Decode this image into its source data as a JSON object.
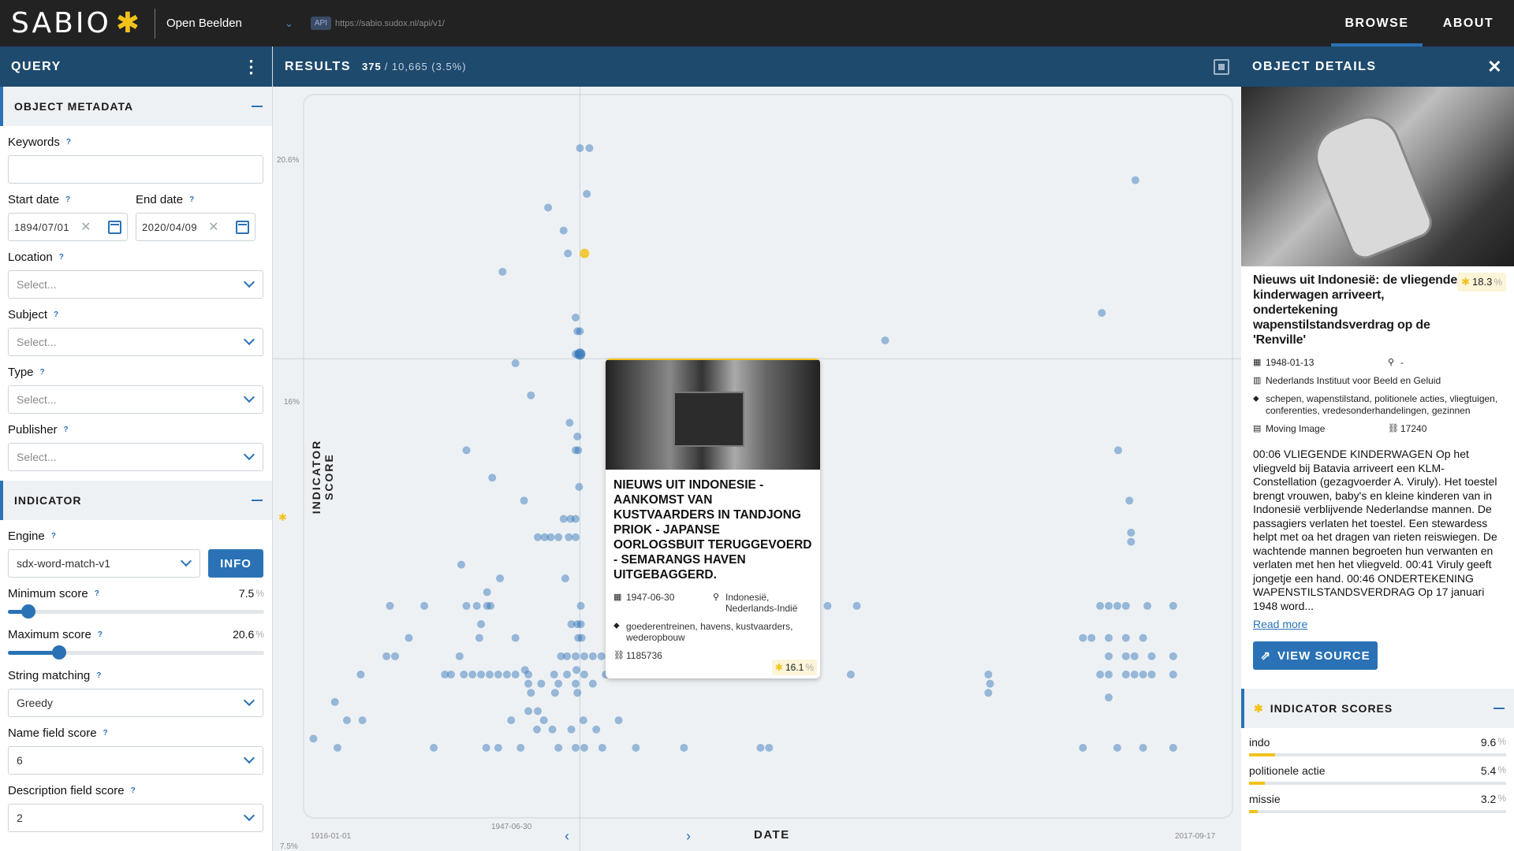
{
  "topbar": {
    "logo": "SABIO",
    "dataset": "Open Beelden",
    "api_badge": "API",
    "api_url": "https://sabio.sudox.nl/api/v1/",
    "nav": [
      {
        "label": "BROWSE",
        "active": true
      },
      {
        "label": "ABOUT",
        "active": false
      }
    ]
  },
  "query": {
    "title": "QUERY",
    "metadata_section": "OBJECT METADATA",
    "keywords_label": "Keywords",
    "keywords_value": "",
    "start_date_label": "Start date",
    "start_date": "1894/07/01",
    "end_date_label": "End date",
    "end_date": "2020/04/09",
    "location_label": "Location",
    "subject_label": "Subject",
    "type_label": "Type",
    "publisher_label": "Publisher",
    "select_placeholder": "Select...",
    "indicator_section": "INDICATOR",
    "engine_label": "Engine",
    "engine_value": "sdx-word-match-v1",
    "info_button": "INFO",
    "min_score_label": "Minimum score",
    "min_score": "7.5",
    "min_score_fraction": 0.08,
    "max_score_label": "Maximum score",
    "max_score": "20.6",
    "max_score_fraction": 0.2,
    "pct_unit": "%",
    "string_matching_label": "String matching",
    "string_matching_value": "Greedy",
    "name_field_label": "Name field score",
    "name_field_value": "6",
    "desc_field_label": "Description field score",
    "desc_field_value": "2"
  },
  "results": {
    "title": "RESULTS",
    "count": "375",
    "total": "/ 10,665 (3.5%)",
    "y_ticks": [
      "20.6%",
      "16%",
      "7.5%"
    ],
    "y_label": "INDICATOR SCORE",
    "x_label": "DATE",
    "x_start": "1916-01-01",
    "x_selected": "1947-06-30",
    "x_end": "2017-09-17"
  },
  "chart_data": {
    "type": "scatter",
    "xlabel": "DATE",
    "ylabel": "INDICATOR SCORE",
    "x_range": [
      "1916-01-01",
      "2017-09-17"
    ],
    "ylim": [
      7.5,
      20.6
    ],
    "selected_point": {
      "x": "1947-06-30",
      "y": 16.1
    },
    "highlighted_point": {
      "x": "1948-01-13",
      "y": 18.3
    },
    "points": [
      [
        1947.5,
        20.6
      ],
      [
        1948.6,
        20.6
      ],
      [
        1948.3,
        19.6
      ],
      [
        1943.8,
        19.3
      ],
      [
        1945.6,
        18.8
      ],
      [
        1946.1,
        18.3
      ],
      [
        1938.5,
        17.9
      ],
      [
        1947.0,
        16.9
      ],
      [
        1947.2,
        16.6
      ],
      [
        1947.5,
        16.6
      ],
      [
        1947.0,
        16.1
      ],
      [
        1947.5,
        16.1
      ],
      [
        1940.0,
        15.9
      ],
      [
        1941.8,
        15.2
      ],
      [
        1946.3,
        14.6
      ],
      [
        1947.2,
        14.3
      ],
      [
        1947.0,
        14.0
      ],
      [
        1947.3,
        14.0
      ],
      [
        1934.3,
        14.0
      ],
      [
        1937.3,
        13.4
      ],
      [
        1947.4,
        13.2
      ],
      [
        1941.0,
        12.9
      ],
      [
        1945.6,
        12.5
      ],
      [
        1946.4,
        12.5
      ],
      [
        1947.0,
        12.5
      ],
      [
        1942.6,
        12.1
      ],
      [
        1943.4,
        12.1
      ],
      [
        1944.1,
        12.1
      ],
      [
        1945.0,
        12.1
      ],
      [
        1946.2,
        12.1
      ],
      [
        1947.0,
        12.1
      ],
      [
        1933.7,
        11.5
      ],
      [
        1938.2,
        11.2
      ],
      [
        1945.8,
        11.2
      ],
      [
        1936.7,
        10.9
      ],
      [
        1925.4,
        10.6
      ],
      [
        1929.4,
        10.6
      ],
      [
        1934.3,
        10.6
      ],
      [
        1935.5,
        10.6
      ],
      [
        1936.7,
        10.6
      ],
      [
        1937.1,
        10.6
      ],
      [
        1947.6,
        10.6
      ],
      [
        1976.3,
        10.6
      ],
      [
        1979.7,
        10.6
      ],
      [
        1936.0,
        10.2
      ],
      [
        1946.5,
        10.2
      ],
      [
        1947.2,
        10.2
      ],
      [
        1947.6,
        10.2
      ],
      [
        1927.6,
        9.9
      ],
      [
        1935.8,
        9.9
      ],
      [
        1940.0,
        9.9
      ],
      [
        1947.3,
        9.9
      ],
      [
        1947.7,
        9.9
      ],
      [
        1925.0,
        9.5
      ],
      [
        1926.0,
        9.5
      ],
      [
        1933.5,
        9.5
      ],
      [
        1945.3,
        9.5
      ],
      [
        1946.0,
        9.5
      ],
      [
        1947.0,
        9.5
      ],
      [
        1948.0,
        9.5
      ],
      [
        1949.0,
        9.5
      ],
      [
        1950.0,
        9.5
      ],
      [
        1951.0,
        9.5
      ],
      [
        1965.0,
        9.5
      ],
      [
        1966.0,
        9.5
      ],
      [
        1969.0,
        9.5
      ],
      [
        1973.0,
        9.5
      ],
      [
        1974.0,
        9.5
      ],
      [
        1941.1,
        9.2
      ],
      [
        1947.1,
        9.2
      ],
      [
        1922.0,
        9.1
      ],
      [
        1931.8,
        9.1
      ],
      [
        1932.5,
        9.1
      ],
      [
        1934.0,
        9.1
      ],
      [
        1935.0,
        9.1
      ],
      [
        1936.0,
        9.1
      ],
      [
        1937.0,
        9.1
      ],
      [
        1938.0,
        9.1
      ],
      [
        1939.0,
        9.1
      ],
      [
        1940.0,
        9.1
      ],
      [
        1941.5,
        9.1
      ],
      [
        1944.5,
        9.1
      ],
      [
        1946.0,
        9.1
      ],
      [
        1948.0,
        9.1
      ],
      [
        1950.5,
        9.1
      ],
      [
        1955.0,
        9.1
      ],
      [
        1961.0,
        9.1
      ],
      [
        1971.0,
        9.1
      ],
      [
        1974.0,
        9.1
      ],
      [
        1979.0,
        9.1
      ],
      [
        1941.5,
        8.9
      ],
      [
        1943.0,
        8.9
      ],
      [
        1945.0,
        8.9
      ],
      [
        1947.0,
        8.9
      ],
      [
        1949.0,
        8.9
      ],
      [
        1941.8,
        8.7
      ],
      [
        1944.6,
        8.7
      ],
      [
        1947.2,
        8.7
      ],
      [
        1919.0,
        8.5
      ],
      [
        1941.5,
        8.3
      ],
      [
        1942.6,
        8.3
      ],
      [
        1920.4,
        8.1
      ],
      [
        1922.2,
        8.1
      ],
      [
        1939.5,
        8.1
      ],
      [
        1943.3,
        8.1
      ],
      [
        1947.9,
        8.1
      ],
      [
        1952.0,
        8.1
      ],
      [
        1942.5,
        7.9
      ],
      [
        1944.3,
        7.9
      ],
      [
        1946.5,
        7.9
      ],
      [
        1949.4,
        7.9
      ],
      [
        1916.5,
        7.7
      ],
      [
        1919.3,
        7.5
      ],
      [
        1930.5,
        7.5
      ],
      [
        1936.6,
        7.5
      ],
      [
        1938.0,
        7.5
      ],
      [
        1940.6,
        7.5
      ],
      [
        1945.0,
        7.5
      ],
      [
        1947.0,
        7.5
      ],
      [
        1948.0,
        7.5
      ],
      [
        1950.1,
        7.5
      ],
      [
        1954.0,
        7.5
      ],
      [
        1959.6,
        7.5
      ],
      [
        1968.5,
        7.5
      ],
      [
        1969.5,
        7.5
      ],
      [
        2012.1,
        19.9
      ],
      [
        2008.2,
        17.0
      ],
      [
        1983.0,
        16.4
      ],
      [
        2010.1,
        14.0
      ],
      [
        2011.4,
        12.9
      ],
      [
        2011.6,
        12.2
      ],
      [
        2011.6,
        12.0
      ],
      [
        2008.0,
        10.6
      ],
      [
        2009.0,
        10.6
      ],
      [
        2010.0,
        10.6
      ],
      [
        2011.0,
        10.6
      ],
      [
        2013.5,
        10.6
      ],
      [
        2016.5,
        10.6
      ],
      [
        2006.0,
        9.9
      ],
      [
        2007.0,
        9.9
      ],
      [
        2009.0,
        9.9
      ],
      [
        2011.0,
        9.9
      ],
      [
        2013.0,
        9.9
      ],
      [
        2009.0,
        9.5
      ],
      [
        2011.0,
        9.5
      ],
      [
        2012.0,
        9.5
      ],
      [
        2014.0,
        9.5
      ],
      [
        2016.5,
        9.5
      ],
      [
        1995.0,
        9.1
      ],
      [
        1995.2,
        8.9
      ],
      [
        1995.0,
        8.7
      ],
      [
        2008.0,
        9.1
      ],
      [
        2009.0,
        9.1
      ],
      [
        2011.0,
        9.1
      ],
      [
        2012.0,
        9.1
      ],
      [
        2013.0,
        9.1
      ],
      [
        2014.0,
        9.1
      ],
      [
        2016.5,
        9.1
      ],
      [
        2009.0,
        8.6
      ],
      [
        2006.0,
        7.5
      ],
      [
        2010.0,
        7.5
      ],
      [
        2013.0,
        7.5
      ],
      [
        2016.5,
        7.5
      ],
      [
        1962.0,
        10.6
      ],
      [
        1964.5,
        10.6
      ],
      [
        1958.5,
        10.2
      ],
      [
        1962.0,
        9.9
      ]
    ]
  },
  "card": {
    "title": "NIEUWS UIT INDONESIE - AANKOMST VAN KUSTVAARDERS IN TANDJONG PRIOK - JAPANSE OORLOGSBUIT TERUGGEVOERD - SEMARANGS HAVEN UITGEBAGGERD.",
    "date": "1947-06-30",
    "location": "Indonesië, Nederlands-Indië",
    "tags": "goederentreinen, havens, kustvaarders, wederopbouw",
    "id": "1185736",
    "score": "16.1",
    "score_unit": "%"
  },
  "details": {
    "panel_title": "OBJECT DETAILS",
    "title": "Nieuws uit Indonesië: de vliegende kinderwagen arriveert, ondertekening wapenstilstandsverdrag op de 'Renville'",
    "score": "18.3",
    "score_unit": "%",
    "date": "1948-01-13",
    "location": "-",
    "publisher": "Nederlands Instituut voor Beeld en Geluid",
    "tags": "schepen, wapenstilstand, politionele acties, vliegtuigen, conferenties, vredesonderhandelingen, gezinnen",
    "type": "Moving Image",
    "id": "17240",
    "description": "00:06 VLIEGENDE KINDERWAGEN Op het vliegveld bij Batavia arriveert een KLM-Constellation (gezagvoerder A. Viruly). Het toestel brengt vrouwen, baby's en kleine kinderen van in Indonesië verblijvende Nederlandse mannen. De passagiers verlaten het toestel. Een stewardess helpt met oa het dragen van rieten reiswiegen. De wachtende mannen begroeten hun verwanten en verlaten met hen het vliegveld. 00:41 Viruly geeft jongetje een hand. 00:46 ONDERTEKENING WAPENSTILSTANDSVERDRAG Op 17 januari 1948 word...",
    "read_more": "Read more",
    "view_source": "VIEW SOURCE",
    "indicator_title": "INDICATOR SCORES",
    "indicators": [
      {
        "name": "indo",
        "value": "9.6",
        "fraction": 0.1
      },
      {
        "name": "politionele actie",
        "value": "5.4",
        "fraction": 0.06
      },
      {
        "name": "missie",
        "value": "3.2",
        "fraction": 0.035
      }
    ]
  },
  "colors": {
    "accent": "#2a72b5",
    "header": "#1e4a6d",
    "topbar": "#222222",
    "star": "#f2c21b",
    "point": "#2a72b5"
  }
}
